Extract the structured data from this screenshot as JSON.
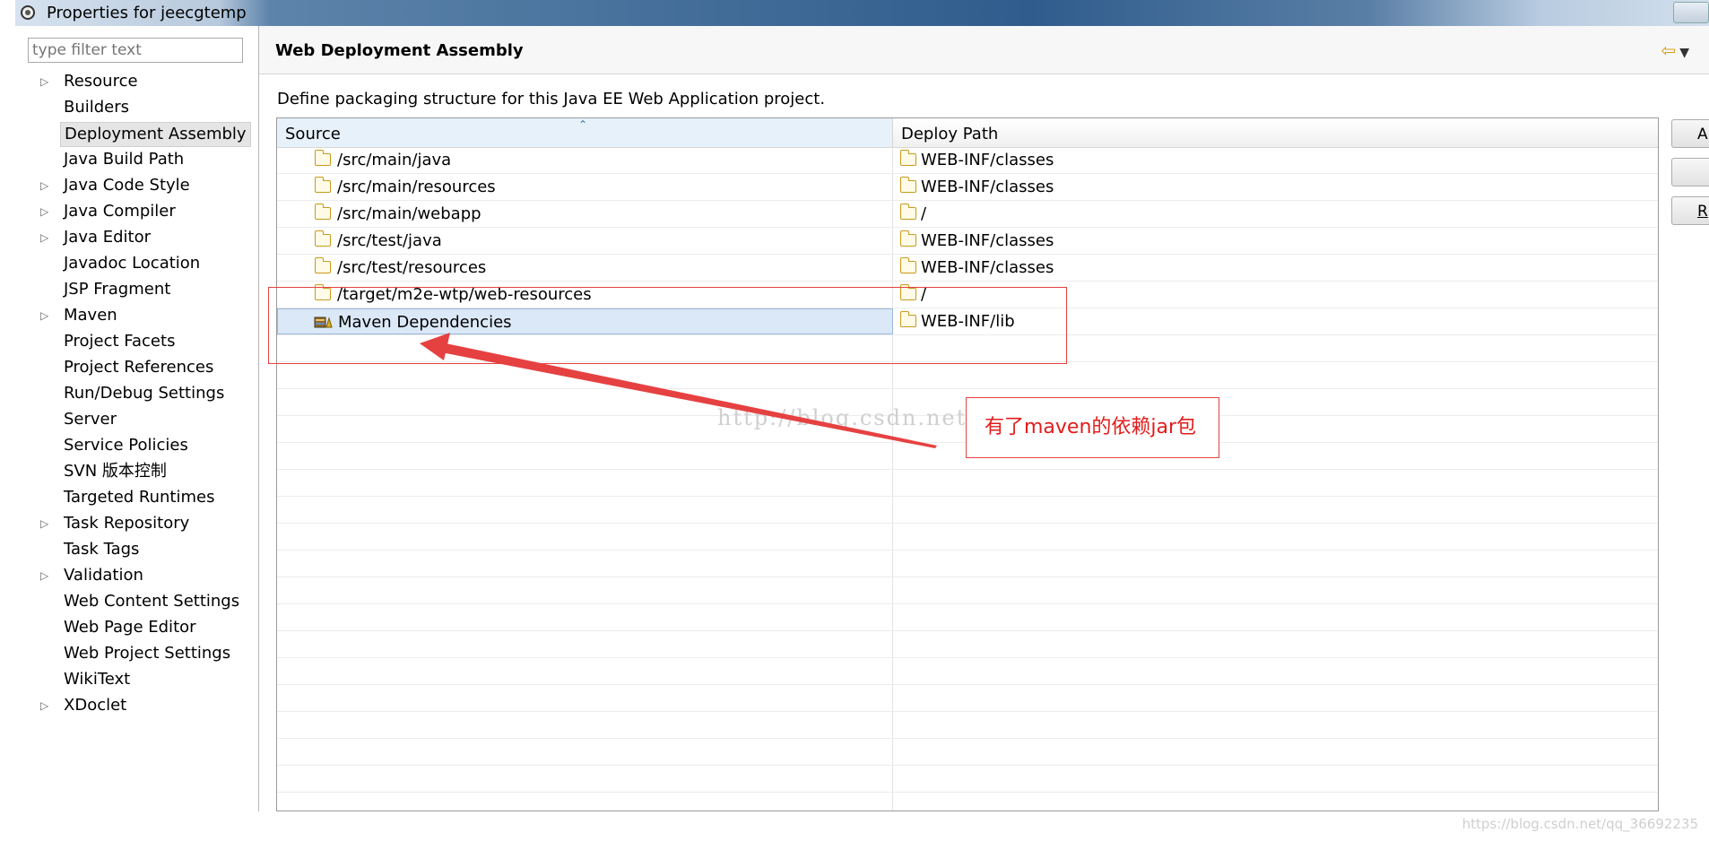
{
  "window": {
    "title": "Properties for jeecgtemp"
  },
  "filter": {
    "placeholder": "type filter text"
  },
  "nav_tree": [
    {
      "label": "Resource",
      "expandable": true
    },
    {
      "label": "Builders",
      "expandable": false
    },
    {
      "label": "Deployment Assembly",
      "expandable": false,
      "selected": true
    },
    {
      "label": "Java Build Path",
      "expandable": false
    },
    {
      "label": "Java Code Style",
      "expandable": true
    },
    {
      "label": "Java Compiler",
      "expandable": true
    },
    {
      "label": "Java Editor",
      "expandable": true
    },
    {
      "label": "Javadoc Location",
      "expandable": false
    },
    {
      "label": "JSP Fragment",
      "expandable": false
    },
    {
      "label": "Maven",
      "expandable": true
    },
    {
      "label": "Project Facets",
      "expandable": false
    },
    {
      "label": "Project References",
      "expandable": false
    },
    {
      "label": "Run/Debug Settings",
      "expandable": false
    },
    {
      "label": "Server",
      "expandable": false
    },
    {
      "label": "Service Policies",
      "expandable": false
    },
    {
      "label": "SVN 版本控制",
      "expandable": false
    },
    {
      "label": "Targeted Runtimes",
      "expandable": false
    },
    {
      "label": "Task Repository",
      "expandable": true
    },
    {
      "label": "Task Tags",
      "expandable": false
    },
    {
      "label": "Validation",
      "expandable": true
    },
    {
      "label": "Web Content Settings",
      "expandable": false
    },
    {
      "label": "Web Page Editor",
      "expandable": false
    },
    {
      "label": "Web Project Settings",
      "expandable": false
    },
    {
      "label": "WikiText",
      "expandable": false
    },
    {
      "label": "XDoclet",
      "expandable": true
    }
  ],
  "page": {
    "title": "Web Deployment Assembly",
    "description": "Define packaging structure for this Java EE Web Application project."
  },
  "table": {
    "columns": {
      "source": "Source",
      "deploy": "Deploy Path"
    },
    "rows": [
      {
        "source": "/src/main/java",
        "deploy": "WEB-INF/classes",
        "icon": "folder-icon"
      },
      {
        "source": "/src/main/resources",
        "deploy": "WEB-INF/classes",
        "icon": "folder-icon"
      },
      {
        "source": "/src/main/webapp",
        "deploy": "/",
        "icon": "folder-icon"
      },
      {
        "source": "/src/test/java",
        "deploy": "WEB-INF/classes",
        "icon": "folder-icon"
      },
      {
        "source": "/src/test/resources",
        "deploy": "WEB-INF/classes",
        "icon": "folder-icon"
      },
      {
        "source": "/target/m2e-wtp/web-resources",
        "deploy": "/",
        "icon": "folder-icon"
      },
      {
        "source": "Maven Dependencies",
        "deploy": "WEB-INF/lib",
        "icon": "library-icon",
        "selected": true
      }
    ]
  },
  "side_buttons": [
    "A",
    "",
    "R"
  ],
  "annotation": {
    "note": "有了maven的依赖jar包"
  },
  "watermarks": {
    "center": "http://blog.csdn.net/zhoppy",
    "corner": "https://blog.csdn.net/qq_36692235"
  },
  "colors": {
    "annotation_red": "#e64141",
    "selection_blue": "#dbe8f7"
  }
}
